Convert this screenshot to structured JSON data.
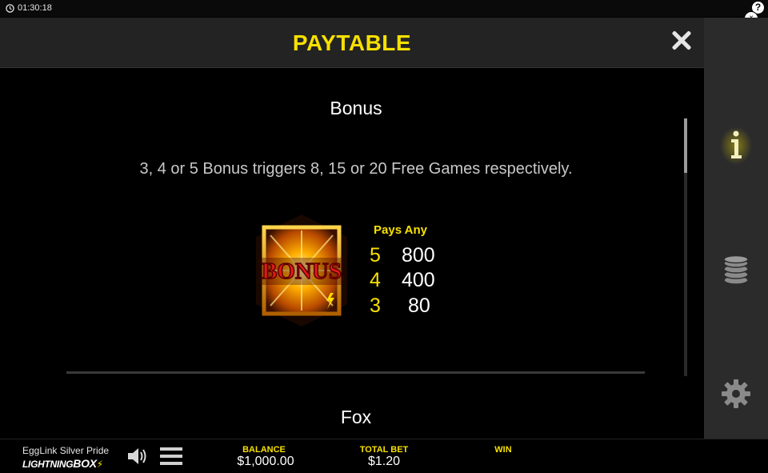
{
  "status": {
    "time": "01:30:18"
  },
  "header": {
    "title": "PAYTABLE"
  },
  "sections": [
    {
      "title": "Bonus",
      "description": "3, 4 or 5 Bonus triggers 8, 15 or 20 Free Games respectively.",
      "symbol_label": "BONUS",
      "pays_header": "Pays Any",
      "pays": [
        {
          "count": "5",
          "value": "800"
        },
        {
          "count": "4",
          "value": "400"
        },
        {
          "count": "3",
          "value": "80"
        }
      ]
    },
    {
      "title": "Fox"
    }
  ],
  "sidebar": {
    "icons": [
      "info-icon",
      "coins-icon",
      "gear-icon"
    ]
  },
  "footer": {
    "game_name": "EggLink Silver Pride",
    "brand_light": "LIGHTNING",
    "brand_bold": "BOX",
    "balance_label": "BALANCE",
    "balance_value": "$1,000.00",
    "total_bet_label": "TOTAL BET",
    "total_bet_value": "$1.20",
    "win_label": "WIN",
    "win_value": ""
  },
  "colors": {
    "accent_yellow": "#f7e000",
    "panel_header": "#232323",
    "side_rail": "#2b2b2b"
  }
}
